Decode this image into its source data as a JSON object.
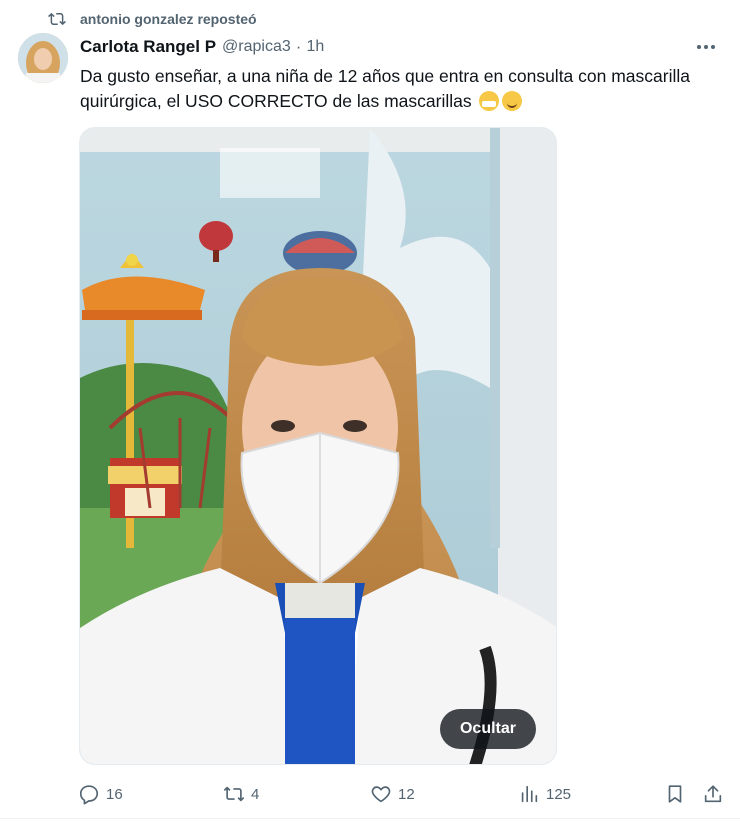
{
  "repost": {
    "text": "antonio gonzalez reposteó",
    "icon": "repost-icon"
  },
  "tweet": {
    "display_name": "Carlota Rangel P",
    "handle": "@rapica3",
    "separator": "·",
    "time": "1h",
    "text": "Da gusto enseñar, a una niña de 12 años que entra en consulta con mascarilla quirúrgica, el USO CORRECTO de las mascarillas",
    "emojis": [
      "face-with-medical-mask-emoji",
      "smiling-face-emoji"
    ]
  },
  "media": {
    "hide_label": "Ocultar"
  },
  "actions": {
    "replies": "16",
    "reposts": "4",
    "likes": "12",
    "views": "125"
  },
  "colors": {
    "text": "#0f1419",
    "muted": "#536471",
    "background": "#ffffff"
  }
}
